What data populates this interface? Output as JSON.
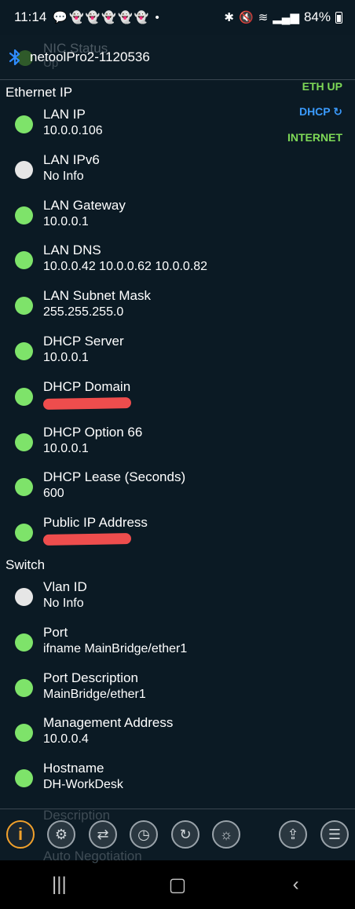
{
  "status_bar": {
    "time": "11:14",
    "notifications": "💬👻👻👻👻👻 •",
    "battery": "84%"
  },
  "header": {
    "device_name": "netoolPro2-1120536",
    "ghost_label": "NIC Status",
    "ghost_value": "Up"
  },
  "side_status": {
    "eth": "ETH UP",
    "dhcp": "DHCP ↻",
    "internet": "INTERNET"
  },
  "sections": {
    "ethernet": "Ethernet IP",
    "switch": "Switch"
  },
  "ethernet_rows": [
    {
      "label": "LAN IP",
      "value": "10.0.0.106",
      "status": "green"
    },
    {
      "label": "LAN IPv6",
      "value": "No Info",
      "status": "white"
    },
    {
      "label": "LAN Gateway",
      "value": "10.0.0.1",
      "status": "green"
    },
    {
      "label": "LAN DNS",
      "value": "10.0.0.42 10.0.0.62 10.0.0.82",
      "status": "green"
    },
    {
      "label": "LAN Subnet Mask",
      "value": "255.255.255.0",
      "status": "green"
    },
    {
      "label": "DHCP Server",
      "value": "10.0.0.1",
      "status": "green"
    },
    {
      "label": "DHCP Domain",
      "value": "",
      "status": "green"
    },
    {
      "label": "DHCP Option 66",
      "value": "10.0.0.1",
      "status": "green"
    },
    {
      "label": "DHCP Lease (Seconds)",
      "value": "600",
      "status": "green"
    },
    {
      "label": "Public IP Address",
      "value": "",
      "status": "green"
    }
  ],
  "switch_rows": [
    {
      "label": "Vlan ID",
      "value": "No Info",
      "status": "white"
    },
    {
      "label": "Port",
      "value": "ifname MainBridge/ether1",
      "status": "green"
    },
    {
      "label": "Port Description",
      "value": "MainBridge/ether1",
      "status": "green"
    },
    {
      "label": "Management Address",
      "value": "10.0.0.4",
      "status": "green"
    },
    {
      "label": "Hostname",
      "value": "DH-WorkDesk",
      "status": "green"
    }
  ],
  "toolbar": {
    "ghost_label": "Description",
    "ghost_label2": "Auto Negotiation",
    "info_glyph": "i"
  },
  "colors": {
    "background": "#0b1a24",
    "green": "#7ee36a",
    "blue": "#3b9cff",
    "accent": "#f2a12b"
  }
}
